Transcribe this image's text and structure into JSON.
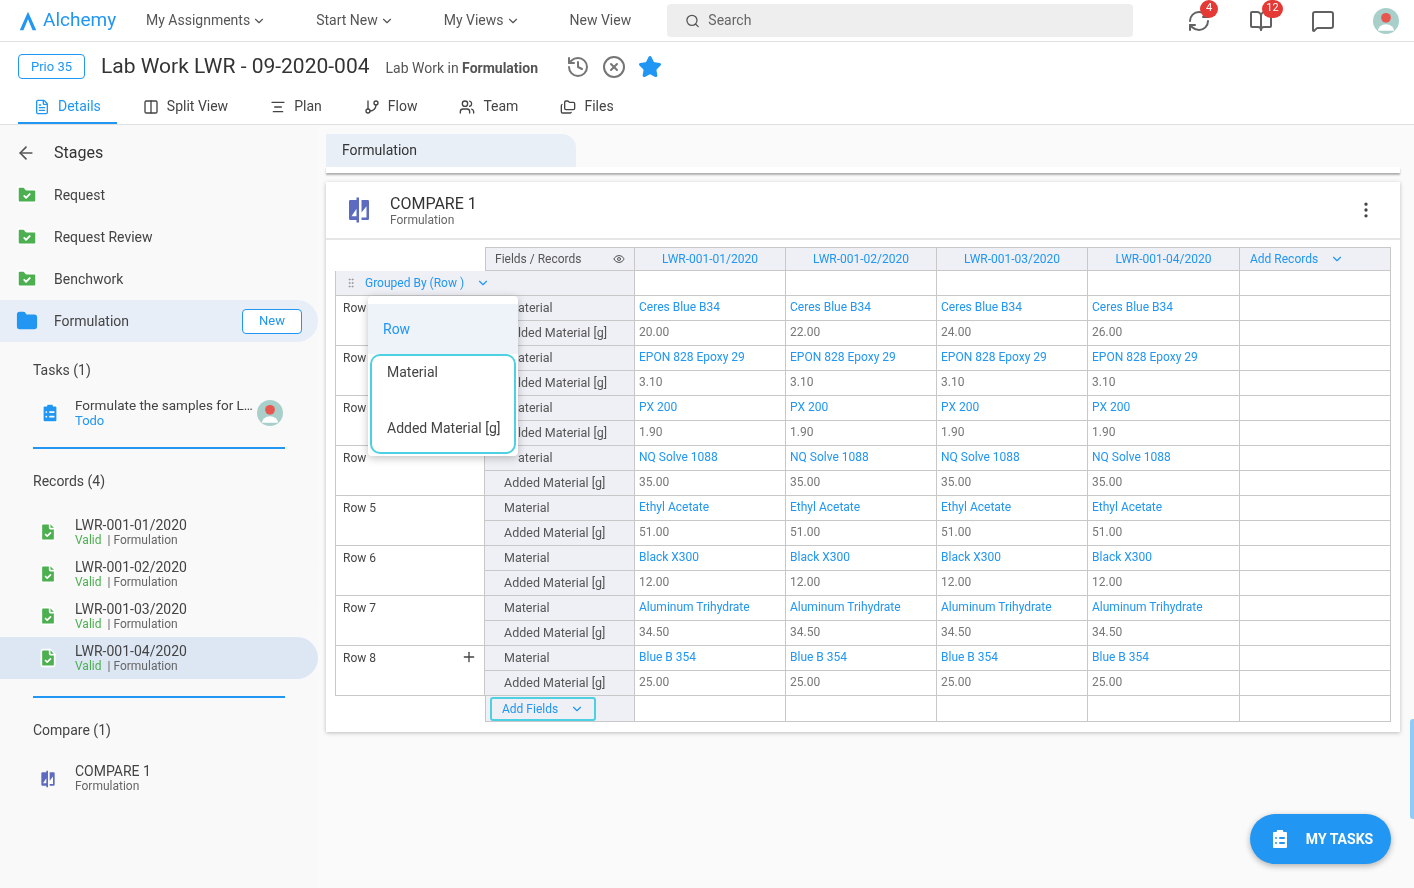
{
  "app": {
    "logo": "Alchemy"
  },
  "nav": [
    {
      "label": "My Assignments",
      "dropdown": true
    },
    {
      "label": "Start New",
      "dropdown": true
    },
    {
      "label": "My Views",
      "dropdown": true
    },
    {
      "label": "New View",
      "dropdown": false
    }
  ],
  "search": {
    "placeholder": "Search"
  },
  "notifications": [
    {
      "kind": "refresh",
      "badge": "4"
    },
    {
      "kind": "book",
      "badge": "12"
    },
    {
      "kind": "chat"
    }
  ],
  "header": {
    "priority": "Prio 35",
    "title": "Lab Work LWR - 09-2020-004",
    "subtitle": "Lab Work in **Formulation**",
    "favorite": true
  },
  "tabs": [
    {
      "label": "Details",
      "kind": "details",
      "selected": true
    },
    {
      "label": "Split View",
      "kind": "split",
      "selected": false
    },
    {
      "label": "Plan",
      "kind": "plan",
      "selected": false
    },
    {
      "label": "Flow",
      "kind": "flow",
      "selected": false
    },
    {
      "label": "Team",
      "kind": "team",
      "selected": false
    },
    {
      "label": "Files",
      "kind": "files",
      "selected": false
    }
  ],
  "sidebar": {
    "title": "Stages",
    "stages": [
      {
        "label": "Request",
        "done": true,
        "selected": false
      },
      {
        "label": "Request Review",
        "done": true,
        "selected": false
      },
      {
        "label": "Benchwork",
        "done": true,
        "selected": false
      },
      {
        "label": "Formulation",
        "done": false,
        "selected": true,
        "badge": "New"
      }
    ],
    "tasks": {
      "title": "Tasks (1)",
      "items": [
        {
          "title": "Formulate the samples for L…",
          "status": "Todo"
        }
      ]
    },
    "records": {
      "title": "Records (4)",
      "items": [
        {
          "name": "LWR-001-01/2020",
          "status": "Valid",
          "stage": "| Formulation",
          "selected": false
        },
        {
          "name": "LWR-001-02/2020",
          "status": "Valid",
          "stage": "| Formulation",
          "selected": false
        },
        {
          "name": "LWR-001-03/2020",
          "status": "Valid",
          "stage": "| Formulation",
          "selected": false
        },
        {
          "name": "LWR-001-04/2020",
          "status": "Valid",
          "stage": "| Formulation",
          "selected": true
        }
      ]
    },
    "compare": {
      "title": "Compare (1)",
      "items": [
        {
          "name": "COMPARE 1",
          "stage": "Formulation"
        }
      ]
    }
  },
  "stage_tab": "Formulation",
  "card": {
    "title": "COMPARE 1",
    "subtitle": "Formulation"
  },
  "table": {
    "fields_header": "Fields / Records",
    "records": [
      "LWR-001-01/2020",
      "LWR-001-02/2020",
      "LWR-001-03/2020",
      "LWR-001-04/2020"
    ],
    "add_records": "Add Records",
    "grouped_by": "Grouped By (Row )",
    "add_fields": "Add Fields",
    "groups": [
      {
        "label": "Row",
        "fields": [
          {
            "kind": "material",
            "label": "aterial",
            "values": [
              "Ceres Blue B34",
              "Ceres Blue B34",
              "Ceres Blue B34",
              "Ceres Blue B34"
            ]
          },
          {
            "kind": "amount",
            "label": "lded Material [g]",
            "values": [
              "20.00",
              "22.00",
              "24.00",
              "26.00"
            ]
          }
        ]
      },
      {
        "label": "Row",
        "fields": [
          {
            "kind": "material",
            "label": "aterial",
            "values": [
              "EPON 828 Epoxy 29",
              "EPON 828 Epoxy 29",
              "EPON 828 Epoxy 29",
              "EPON 828 Epoxy 29"
            ]
          },
          {
            "kind": "amount",
            "label": "lded Material [g]",
            "values": [
              "3.10",
              "3.10",
              "3.10",
              "3.10"
            ]
          }
        ]
      },
      {
        "label": "Row",
        "fields": [
          {
            "kind": "material",
            "label": "aterial",
            "values": [
              "PX 200",
              "PX 200",
              "PX 200",
              "PX 200"
            ]
          },
          {
            "kind": "amount",
            "label": "lded Material [g]",
            "values": [
              "1.90",
              "1.90",
              "1.90",
              "1.90"
            ]
          }
        ]
      },
      {
        "label": "Row",
        "fields": [
          {
            "kind": "material",
            "label": "aterial",
            "values": [
              "NQ Solve 1088",
              "NQ Solve 1088",
              "NQ Solve 1088",
              "NQ Solve 1088"
            ]
          },
          {
            "kind": "amount",
            "label": "Added Material [g]",
            "values": [
              "35.00",
              "35.00",
              "35.00",
              "35.00"
            ]
          }
        ]
      },
      {
        "label": "Row 5",
        "fields": [
          {
            "kind": "material",
            "label": "Material",
            "values": [
              "Ethyl Acetate",
              "Ethyl Acetate",
              "Ethyl Acetate",
              "Ethyl Acetate"
            ]
          },
          {
            "kind": "amount",
            "label": "Added Material [g]",
            "values": [
              "51.00",
              "51.00",
              "51.00",
              "51.00"
            ]
          }
        ]
      },
      {
        "label": "Row 6",
        "fields": [
          {
            "kind": "material",
            "label": "Material",
            "values": [
              "Black X300",
              "Black X300",
              "Black X300",
              "Black X300"
            ]
          },
          {
            "kind": "amount",
            "label": "Added Material [g]",
            "values": [
              "12.00",
              "12.00",
              "12.00",
              "12.00"
            ]
          }
        ]
      },
      {
        "label": "Row 7",
        "fields": [
          {
            "kind": "material",
            "label": "Material",
            "values": [
              "Aluminum Trihydrate",
              "Aluminum Trihydrate",
              "Aluminum Trihydrate",
              "Aluminum Trihydrate"
            ]
          },
          {
            "kind": "amount",
            "label": "Added Material [g]",
            "values": [
              "34.50",
              "34.50",
              "34.50",
              "34.50"
            ]
          }
        ]
      },
      {
        "label": "Row 8",
        "add": true,
        "fields": [
          {
            "kind": "material",
            "label": "Material",
            "values": [
              "Blue B 354",
              "Blue B 354",
              "Blue B 354",
              "Blue B 354"
            ]
          },
          {
            "kind": "amount",
            "label": "Added Material [g]",
            "values": [
              "25.00",
              "25.00",
              "25.00",
              "25.00"
            ]
          }
        ]
      }
    ]
  },
  "group_menu": {
    "open": true,
    "items": [
      {
        "label": "Row",
        "selected": true
      },
      {
        "label": "Material",
        "selected": false
      },
      {
        "label": "Added Material [g]",
        "selected": false
      }
    ]
  },
  "fab": {
    "label": "MY TASKS"
  }
}
